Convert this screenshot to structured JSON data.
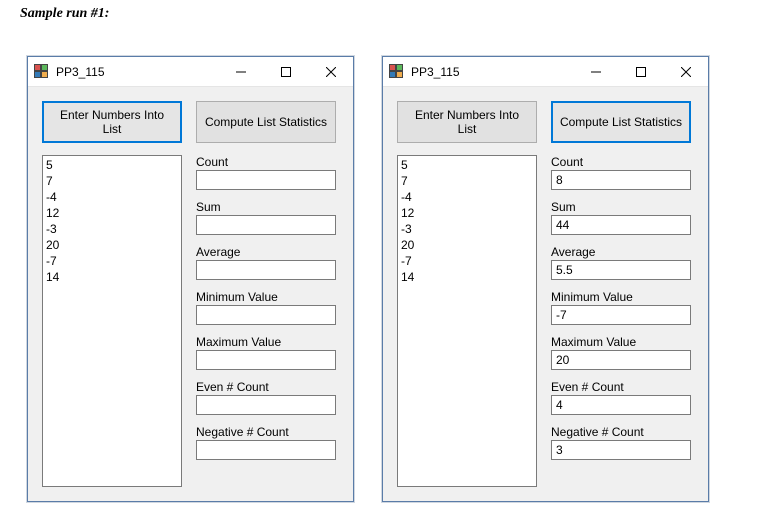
{
  "caption": "Sample run #1:",
  "windows": [
    {
      "title": "PP3_115",
      "buttons": {
        "enter_label": "Enter Numbers Into List",
        "compute_label": "Compute List Statistics"
      },
      "focused_button": "enter",
      "list_items": [
        "5",
        "7",
        "-4",
        "12",
        "-3",
        "20",
        "-7",
        "14"
      ],
      "fields": {
        "count_label": "Count",
        "count_value": "",
        "sum_label": "Sum",
        "sum_value": "",
        "average_label": "Average",
        "average_value": "",
        "min_label": "Minimum Value",
        "min_value": "",
        "max_label": "Maximum Value",
        "max_value": "",
        "even_label": "Even # Count",
        "even_value": "",
        "neg_label": "Negative # Count",
        "neg_value": ""
      }
    },
    {
      "title": "PP3_115",
      "buttons": {
        "enter_label": "Enter Numbers Into List",
        "compute_label": "Compute List Statistics"
      },
      "focused_button": "compute",
      "list_items": [
        "5",
        "7",
        "-4",
        "12",
        "-3",
        "20",
        "-7",
        "14"
      ],
      "fields": {
        "count_label": "Count",
        "count_value": "8",
        "sum_label": "Sum",
        "sum_value": "44",
        "average_label": "Average",
        "average_value": "5.5",
        "min_label": "Minimum Value",
        "min_value": "-7",
        "max_label": "Maximum Value",
        "max_value": "20",
        "even_label": "Even # Count",
        "even_value": "4",
        "neg_label": "Negative # Count",
        "neg_value": "3"
      }
    }
  ]
}
